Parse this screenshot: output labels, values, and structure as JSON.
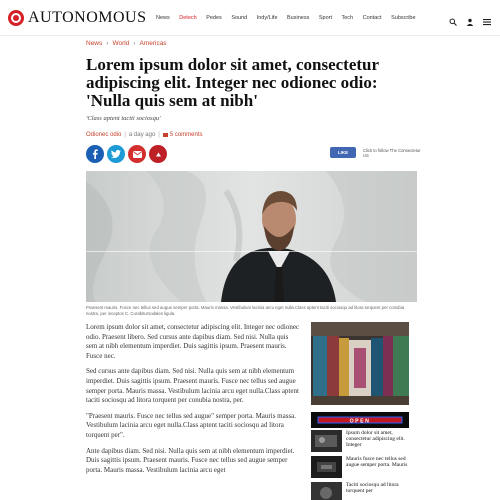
{
  "header": {
    "logo_text": "AUTONOMOUS",
    "nav": [
      {
        "label": "News",
        "active": false
      },
      {
        "label": "Detech",
        "active": true
      },
      {
        "label": "Pedes",
        "active": false
      },
      {
        "label": "Sound",
        "active": false
      },
      {
        "label": "Indy/Life",
        "active": false
      },
      {
        "label": "Business",
        "active": false
      },
      {
        "label": "Sport",
        "active": false
      },
      {
        "label": "Tech",
        "active": false
      },
      {
        "label": "Contact",
        "active": false
      },
      {
        "label": "Subscribe",
        "active": false
      }
    ],
    "icons": [
      "search-icon",
      "user-icon",
      "menu-icon"
    ]
  },
  "breadcrumb": [
    "News",
    "World",
    "Americas"
  ],
  "article": {
    "title": "Lorem ipsum dolor sit amet, consectetur adipiscing elit. Integer nec odionec odio: 'Nulla quis sem at nibh'",
    "subtitle": "'Class aptent taciti sociosqu'",
    "author": "Odionec odio",
    "time": "a day ago",
    "comments": "5 comments",
    "like_label": "LIKE",
    "follow_text": "Click to follow The Consectetur US",
    "caption": "Praesent mauris. Fusce nec tellus sed augue semper porta. Mauris massa. Vestibulum lacinia arcu eget nulla.Class aptent taciti sociosqu ad litora torquent per conubia nostra, per inceptos C. Curabitursodales ligula.",
    "paragraphs": [
      "Lorem ipsum dolor sit amet, consectetur adipiscing elit. Integer nec odionec odio. Praesent libero. Sed cursus ante dapibus diam. Sed nisi. Nulla quis sem at nibh elementum imperdiet. Duis sagittis ipsum. Praesent mauris. Fusce nec.",
      "Sed cursus ante dapibus diam. Sed nisi. Nulla quis sem at nibh elementum imperdiet. Duis sagittis ipsum. Praesent mauris. Fusce nec tellus sed augue semper porta. Mauris massa. Vestibulum lacinia arcu eget nulla.Class aptent taciti sociosqu ad litora torquent per conubia nostra, per.",
      "\"Praesent mauris. Fusce nec tellus sed augue\" semper porta. Mauris massa. Vestibulum lacinia arcu eget nulla.Class aptent taciti sociosqu ad litora torquent per\".",
      "Ante dapibus diam. Sed nisi. Nulla quis sem at nibh elementum imperdiet. Duis sagittis ipsum. Praesent mauris. Fusce nec tellus sed augue semper porta. Mauris massa. Vestibulum lacinia arcu eget"
    ]
  },
  "sidebar": {
    "banner_text": "OPEN",
    "related": [
      {
        "text": "Ipsum dolor sit amet, consectetur adipiscing elit. Integer"
      },
      {
        "text": "Mauris fusce nec tellus sed augue semper porta. Mauris"
      },
      {
        "text": "Taciti sociosqu ad litora torquent per"
      }
    ]
  },
  "colors": {
    "accent": "#d42027",
    "link": "#c8412c",
    "facebook": "#1a5fb4",
    "twitter": "#1d9bd6",
    "email": "#d32f2f",
    "pinterest": "#bd2026"
  }
}
